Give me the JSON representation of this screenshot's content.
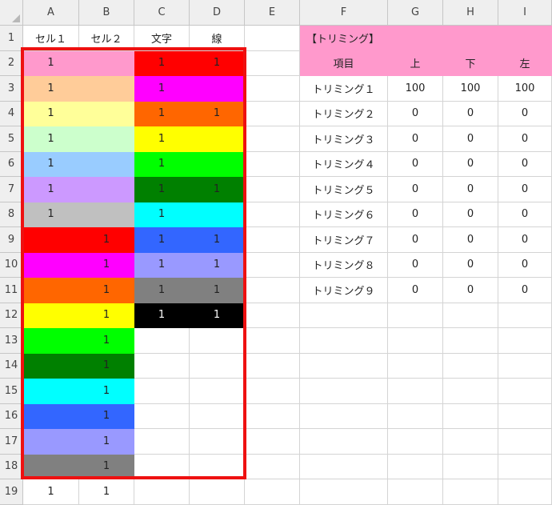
{
  "columns": [
    "A",
    "B",
    "C",
    "D",
    "E",
    "F",
    "G",
    "H",
    "I"
  ],
  "rows": [
    "1",
    "2",
    "3",
    "4",
    "5",
    "6",
    "7",
    "8",
    "9",
    "10",
    "11",
    "12",
    "13",
    "14",
    "15",
    "16",
    "17",
    "18",
    "19"
  ],
  "header_row": {
    "A": "セル１",
    "B": "セル２",
    "C": "文字",
    "D": "線"
  },
  "table_rows": [
    {
      "a": "1",
      "b": "",
      "c": "1",
      "d": "1"
    },
    {
      "a": "1",
      "b": "",
      "c": "1",
      "d": ""
    },
    {
      "a": "1",
      "b": "",
      "c": "1",
      "d": "1"
    },
    {
      "a": "1",
      "b": "",
      "c": "1",
      "d": ""
    },
    {
      "a": "1",
      "b": "",
      "c": "1",
      "d": ""
    },
    {
      "a": "1",
      "b": "",
      "c": "1",
      "d": "1"
    },
    {
      "a": "1",
      "b": "",
      "c": "1",
      "d": ""
    },
    {
      "a": "",
      "b": "1",
      "c": "1",
      "d": "1"
    },
    {
      "a": "",
      "b": "1",
      "c": "1",
      "d": "1"
    },
    {
      "a": "",
      "b": "1",
      "c": "1",
      "d": "1"
    },
    {
      "a": "",
      "b": "1",
      "c": "1",
      "d": "1"
    },
    {
      "a": "",
      "b": "1",
      "c": "",
      "d": ""
    },
    {
      "a": "",
      "b": "1",
      "c": "",
      "d": ""
    },
    {
      "a": "",
      "b": "1",
      "c": "",
      "d": ""
    },
    {
      "a": "",
      "b": "1",
      "c": "",
      "d": ""
    },
    {
      "a": "",
      "b": "1",
      "c": "",
      "d": ""
    },
    {
      "a": "",
      "b": "1",
      "c": "",
      "d": ""
    },
    {
      "a": "1",
      "b": "1",
      "c": "",
      "d": ""
    }
  ],
  "colors": {
    "ab": [
      "#ff99cc",
      "#ffcc99",
      "#ffff99",
      "#ccffcc",
      "#99ccff",
      "#cc99ff",
      "#c0c0c0",
      "#ff0000",
      "#ff00ff",
      "#ff6600",
      "#ffff00",
      "#00ff00",
      "#008000",
      "#00ffff",
      "#3366ff",
      "#9999ff",
      "#808080",
      "#ffffff"
    ],
    "cd": [
      "#ff0000",
      "#ff00ff",
      "#ff6600",
      "#ffff00",
      "#00ff00",
      "#008000",
      "#00ffff",
      "#3366ff",
      "#9999ff",
      "#808080",
      "#000000",
      "#ffffff",
      "#ffffff",
      "#ffffff",
      "#ffffff",
      "#ffffff",
      "#ffffff",
      "#ffffff"
    ],
    "cd_text": [
      "#222222",
      "#222222",
      "#222222",
      "#222222",
      "#222222",
      "#222222",
      "#222222",
      "#222222",
      "#222222",
      "#222222",
      "#ffffff",
      "#222222",
      "#222222",
      "#222222",
      "#222222",
      "#222222",
      "#222222",
      "#222222"
    ],
    "pink_header": "#ff99cc",
    "outline": "#ee1111"
  },
  "trim": {
    "title": "【トリミング】",
    "headers": [
      "項目",
      "上",
      "下",
      "左"
    ],
    "rows": [
      {
        "label": "トリミング１",
        "v1": "100",
        "v2": "100",
        "v3": "100"
      },
      {
        "label": "トリミング２",
        "v1": "0",
        "v2": "0",
        "v3": "0"
      },
      {
        "label": "トリミング３",
        "v1": "0",
        "v2": "0",
        "v3": "0"
      },
      {
        "label": "トリミング４",
        "v1": "0",
        "v2": "0",
        "v3": "0"
      },
      {
        "label": "トリミング５",
        "v1": "0",
        "v2": "0",
        "v3": "0"
      },
      {
        "label": "トリミング６",
        "v1": "0",
        "v2": "0",
        "v3": "0"
      },
      {
        "label": "トリミング７",
        "v1": "0",
        "v2": "0",
        "v3": "0"
      },
      {
        "label": "トリミング８",
        "v1": "0",
        "v2": "0",
        "v3": "0"
      },
      {
        "label": "トリミング９",
        "v1": "0",
        "v2": "0",
        "v3": "0"
      }
    ]
  }
}
